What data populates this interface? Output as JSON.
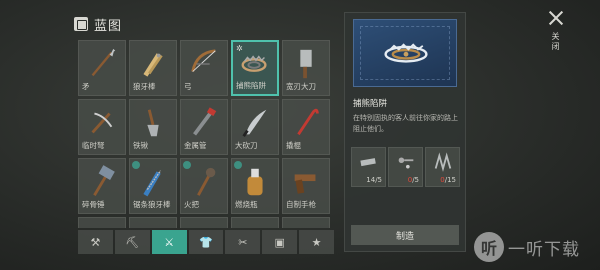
{
  "header": {
    "title": "蓝图",
    "icon": "blueprint-icon"
  },
  "items": [
    {
      "label": "矛",
      "icon": "spear-icon",
      "selected": false,
      "badge": ""
    },
    {
      "label": "狼牙棒",
      "icon": "spiked-club-icon",
      "selected": false,
      "badge": ""
    },
    {
      "label": "弓",
      "icon": "bow-icon",
      "selected": false,
      "badge": ""
    },
    {
      "label": "捕熊陷阱",
      "icon": "bear-trap-icon",
      "selected": true,
      "badge": "star"
    },
    {
      "label": "宽刃大刀",
      "icon": "cleaver-icon",
      "selected": false,
      "badge": ""
    },
    {
      "label": "临时弩",
      "icon": "crossbow-icon",
      "selected": false,
      "badge": ""
    },
    {
      "label": "铁锹",
      "icon": "shovel-icon",
      "selected": false,
      "badge": ""
    },
    {
      "label": "金属管",
      "icon": "metal-pipe-icon",
      "selected": false,
      "badge": ""
    },
    {
      "label": "大砍刀",
      "icon": "machete-icon",
      "selected": false,
      "badge": ""
    },
    {
      "label": "撬棍",
      "icon": "crowbar-icon",
      "selected": false,
      "badge": ""
    },
    {
      "label": "碎骨锤",
      "icon": "hammer-icon",
      "selected": false,
      "badge": ""
    },
    {
      "label": "锯条狼牙棒",
      "icon": "saw-club-icon",
      "selected": false,
      "badge": "dot"
    },
    {
      "label": "火把",
      "icon": "torch-icon",
      "selected": false,
      "badge": "dot"
    },
    {
      "label": "燃烧瓶",
      "icon": "molotov-icon",
      "selected": false,
      "badge": "dot"
    },
    {
      "label": "自制手枪",
      "icon": "pistol-icon",
      "selected": false,
      "badge": ""
    },
    {
      "label": "",
      "icon": "item-icon",
      "selected": false,
      "badge": ""
    },
    {
      "label": "",
      "icon": "item-icon",
      "selected": false,
      "badge": ""
    },
    {
      "label": "",
      "icon": "item-icon",
      "selected": false,
      "badge": ""
    },
    {
      "label": "",
      "icon": "item-icon",
      "selected": false,
      "badge": ""
    },
    {
      "label": "",
      "icon": "item-icon",
      "selected": false,
      "badge": ""
    }
  ],
  "tabs": [
    {
      "icon": "tools-icon",
      "active": false
    },
    {
      "icon": "pickaxe-icon",
      "active": false
    },
    {
      "icon": "weapons-icon",
      "active": true
    },
    {
      "icon": "clothing-icon",
      "active": false
    },
    {
      "icon": "misc-icon",
      "active": false
    },
    {
      "icon": "chest-icon",
      "active": false
    },
    {
      "icon": "star-icon",
      "active": false
    }
  ],
  "detail": {
    "name": "捕熊陷阱",
    "description": "在特别固执的客人前往你家的路上阻止他们。",
    "materials": [
      {
        "icon": "iron-bar-icon",
        "have": "14",
        "need": "/5",
        "short": false
      },
      {
        "icon": "screws-icon",
        "have": "0",
        "need": "/5",
        "short": true
      },
      {
        "icon": "spring-icon",
        "have": "0",
        "need": "/15",
        "short": true
      }
    ],
    "craft_label": "制造"
  },
  "close_label": "关闭",
  "watermark": {
    "logo": "听",
    "text": "一听下载"
  },
  "colors": {
    "accent": "#3aa48f",
    "shortage": "#e0493c",
    "preview": "#2e4f77"
  }
}
